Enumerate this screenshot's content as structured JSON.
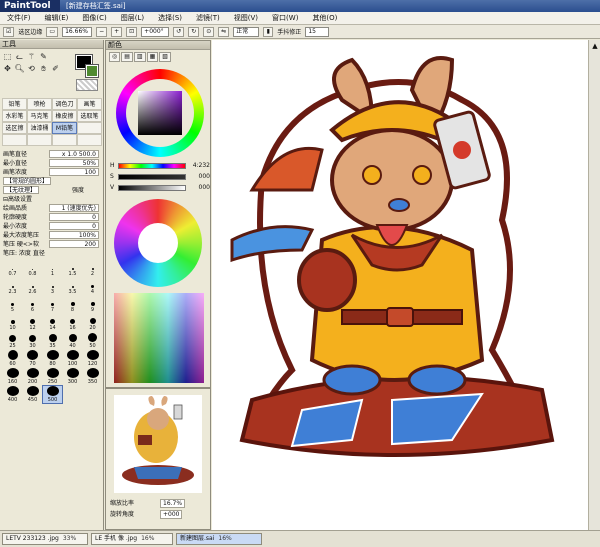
{
  "window": {
    "app_name": "PaintTool SAI",
    "title": "[新建存档汇签.sai]"
  },
  "menu": [
    "文件(F)",
    "编辑(E)",
    "图像(C)",
    "图层(L)",
    "选择(S)",
    "滤镜(T)",
    "视图(V)",
    "窗口(W)",
    "其他(O)"
  ],
  "toolbar": {
    "selection_edge_label": "选区边缘",
    "zoom": "16.66%",
    "rotation": "+000°",
    "blend_mode": "正常",
    "stabilizer_label": "手抖修正",
    "stabilizer_value": "15"
  },
  "tool_panel": {
    "title": "工具",
    "brushes": [
      "铅笔",
      "喷枪",
      "调色刀",
      "画笔",
      "水彩笔",
      "马克笔",
      "橡皮擦",
      "选取笔",
      "选区擦",
      "油漆桶",
      "M铅笔",
      "",
      "",
      "",
      "",
      ""
    ],
    "properties": [
      {
        "label": "画笔直径",
        "value": "x 1.0    500.0"
      },
      {
        "label": "最小直径",
        "value": "50%"
      },
      {
        "label": "画笔浓度",
        "value": "100"
      },
      {
        "label": "【常规的圆形】",
        "value": ""
      },
      {
        "label": "【无纹理】",
        "value": "强度"
      },
      {
        "label": "高级设置",
        "value": ""
      },
      {
        "label": "绘画品质",
        "value": "1 (速度优先)"
      },
      {
        "label": "轮廓硬度",
        "value": "0"
      },
      {
        "label": "最小浓度",
        "value": "0"
      },
      {
        "label": "最大浓度笔压",
        "value": "100%"
      },
      {
        "label": "笔压 硬<>软",
        "value": "200"
      },
      {
        "label": "笔压: 浓度  直径",
        "value": ""
      }
    ],
    "brush_sizes": [
      "0.7",
      "0.8",
      "1",
      "1.5",
      "2",
      "2.3",
      "2.6",
      "3",
      "3.5",
      "4",
      "5",
      "6",
      "7",
      "8",
      "9",
      "10",
      "12",
      "14",
      "16",
      "20",
      "25",
      "30",
      "35",
      "40",
      "50",
      "60",
      "70",
      "80",
      "100",
      "120",
      "160",
      "200",
      "250",
      "300",
      "350",
      "400",
      "450",
      "500"
    ],
    "selected_size": "500"
  },
  "color_panel": {
    "title": "颜色",
    "sliders": [
      {
        "label": "H",
        "value": "4:232"
      },
      {
        "label": "S",
        "value": "000"
      },
      {
        "label": "V",
        "value": "000"
      }
    ],
    "current_color": "#000000"
  },
  "navigator": {
    "zoom_label": "缩放比率",
    "zoom_value": "16.7%",
    "rotation_label": "旋转角度",
    "rotation_value": "+000"
  },
  "tabs": [
    {
      "name": "LETV 233123 .jpg",
      "pct": "33%"
    },
    {
      "name": "LE 手机 像 .jpg",
      "pct": "16%"
    },
    {
      "name": "新建图层.sai",
      "pct": "16%"
    }
  ]
}
